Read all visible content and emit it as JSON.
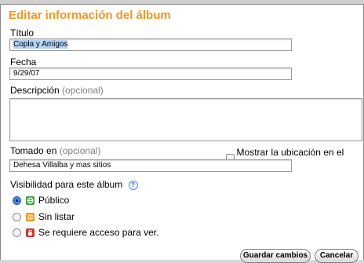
{
  "dialog": {
    "title": "Editar información del álbum"
  },
  "form": {
    "title_label": "Título",
    "title_value": "Copla y Amigos",
    "date_label": "Fecha",
    "date_value": "9/29/07",
    "description_label": "Descripción",
    "description_optional": "(opcional)",
    "description_value": "",
    "taken_label": "Tomado en",
    "taken_optional": "(opcional)",
    "taken_value": "Dehesa Villalba y mas sitios",
    "show_map_label": "Mostrar la ubicación en el mapa",
    "show_map_checked": false
  },
  "visibility": {
    "label": "Visibilidad para este álbum",
    "help_icon": "?",
    "options": [
      {
        "label": "Público",
        "icon": "globe-icon",
        "selected": true,
        "icon_color": "#3aa43a"
      },
      {
        "label": "Sin listar",
        "icon": "unlisted-icon",
        "selected": false,
        "icon_color": "#f39a1e"
      },
      {
        "label": "Se requiere acceso para ver.",
        "icon": "lock-icon",
        "selected": false,
        "icon_color": "#d9302b"
      }
    ]
  },
  "buttons": {
    "save": "Guardar cambios",
    "cancel": "Cancelar"
  },
  "colors": {
    "accent": "#f7941d",
    "optional_text": "#7f7f7f",
    "selection": "#b4d3f7"
  }
}
